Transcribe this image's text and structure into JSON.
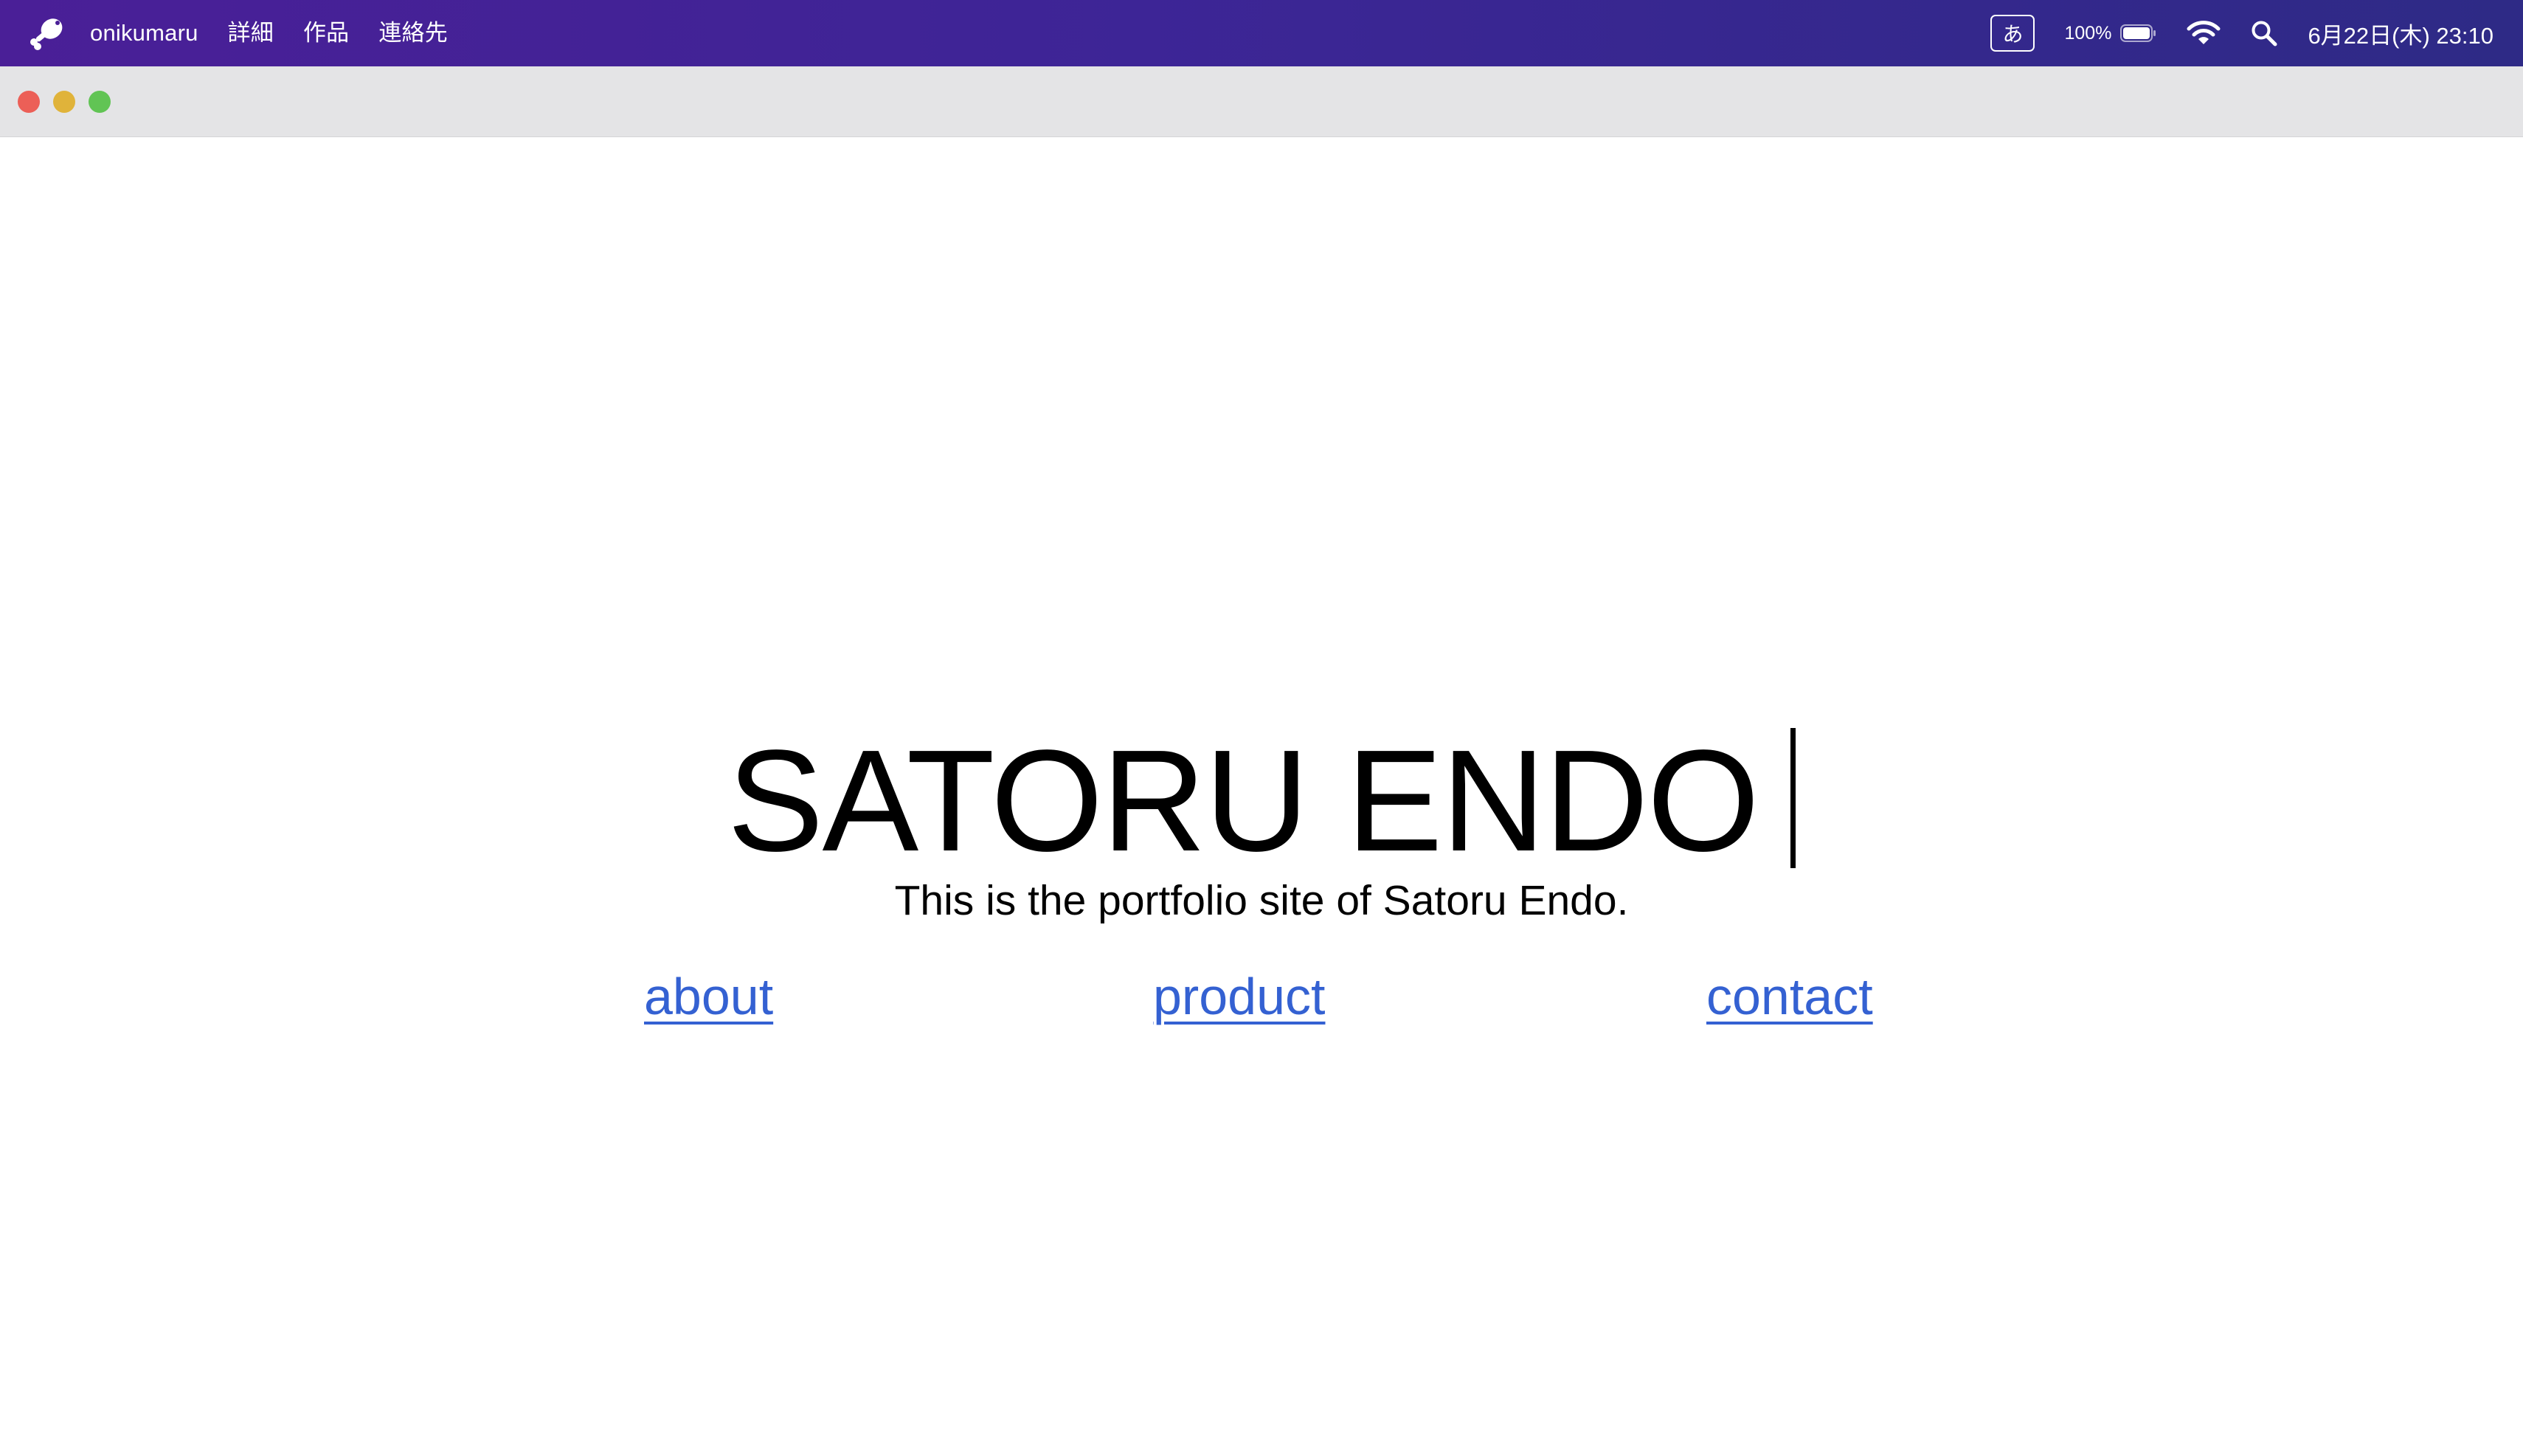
{
  "menubar": {
    "app_icon": "chicken-leg-icon",
    "items": [
      {
        "label": "onikumaru"
      },
      {
        "label": "詳細"
      },
      {
        "label": "作品"
      },
      {
        "label": "連絡先"
      }
    ],
    "input_method": "あ",
    "battery_percent": "100%",
    "battery_level": 1.0,
    "clock": "6月22日(木) 23:10",
    "gradient_colors": [
      "#4a1f97",
      "#2e2a86"
    ]
  },
  "window": {
    "traffic_lights": [
      {
        "name": "close",
        "color": "#ec5f57"
      },
      {
        "name": "minimize",
        "color": "#e0b33a"
      },
      {
        "name": "zoom",
        "color": "#61c454"
      }
    ]
  },
  "page": {
    "title": "SATORU ENDO",
    "subtitle": "This is the portfolio site of Satoru Endo.",
    "nav": [
      {
        "label": "about"
      },
      {
        "label": "product"
      },
      {
        "label": "contact"
      }
    ],
    "link_color": "#3461d2"
  }
}
